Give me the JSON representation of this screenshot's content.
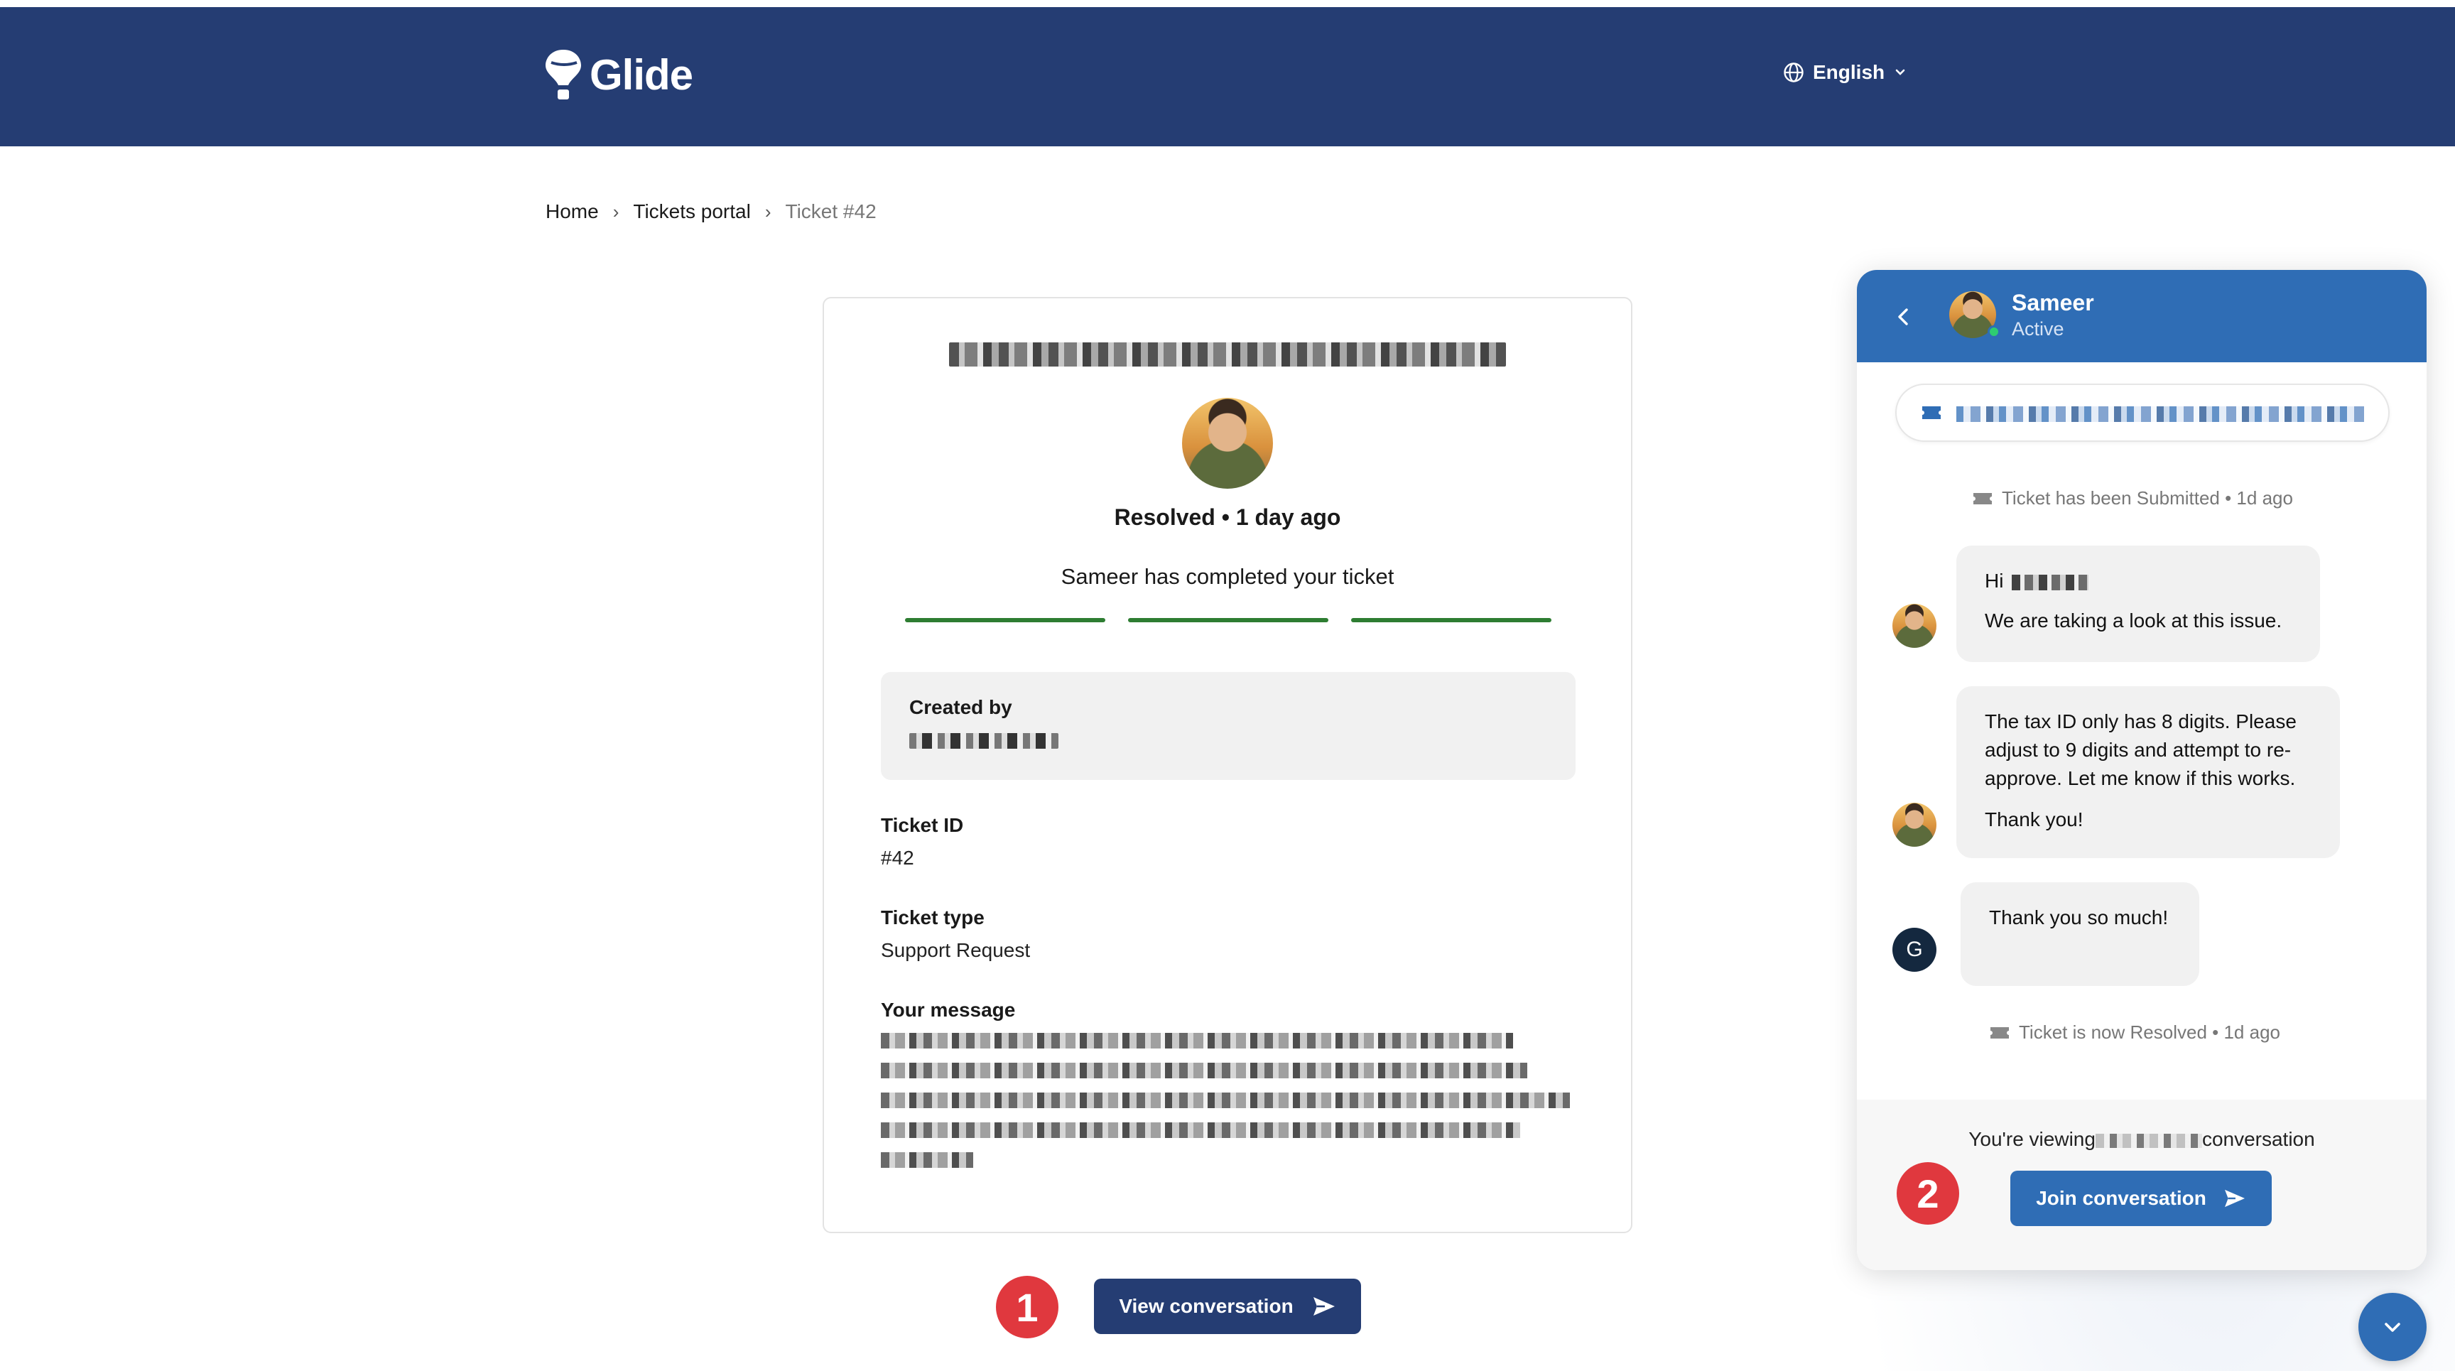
{
  "header": {
    "brand": "Glide",
    "language": "English"
  },
  "breadcrumb": {
    "home": "Home",
    "portal": "Tickets portal",
    "current": "Ticket #42"
  },
  "ticket": {
    "status_line": "Resolved • 1 day ago",
    "completed_text": "Sameer has completed your ticket",
    "progress_steps": 3,
    "created_by_label": "Created by",
    "ticket_id_label": "Ticket ID",
    "ticket_id_value": "#42",
    "ticket_type_label": "Ticket type",
    "ticket_type_value": "Support Request",
    "message_label": "Your message"
  },
  "actions": {
    "step1_badge": "1",
    "view_conversation_label": "View conversation",
    "step2_badge": "2",
    "join_conversation_label": "Join conversation"
  },
  "chat": {
    "agent_name": "Sameer",
    "agent_status": "Active",
    "events": {
      "submitted": "Ticket has been Submitted • 1d ago",
      "resolved": "Ticket is now Resolved • 1d ago"
    },
    "messages": [
      {
        "greeting": "Hi",
        "line": "We are taking a look at this issue."
      },
      {
        "text": "The tax ID only has 8 digits. Please adjust to 9 digits and attempt to re-approve. Let me know if this works.",
        "sign": "Thank you!"
      },
      {
        "text": "Thank you so much!",
        "avatar_initial": "G"
      }
    ],
    "viewing_prefix": "You're viewing",
    "viewing_suffix": "conversation"
  },
  "colors": {
    "header_bg": "#253d73",
    "chat_header_bg": "#2f6db5",
    "progress": "#2e7d32",
    "badge": "#e0383e"
  }
}
